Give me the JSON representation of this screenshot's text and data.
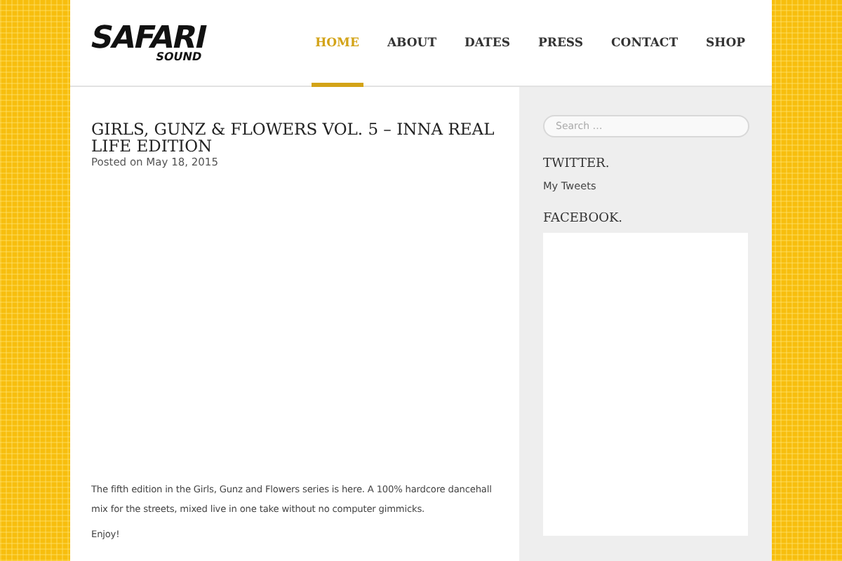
{
  "logo": {
    "main": "SAFARI",
    "sub": "SOUND"
  },
  "nav": [
    {
      "label": "HOME",
      "selected": true
    },
    {
      "label": "ABOUT",
      "selected": false
    },
    {
      "label": "DATES",
      "selected": false
    },
    {
      "label": "PRESS",
      "selected": false
    },
    {
      "label": "CONTACT",
      "selected": false
    },
    {
      "label": "SHOP",
      "selected": false
    }
  ],
  "post": {
    "title": "GIRLS, GUNZ & FLOWERS VOL. 5 – INNA REAL LIFE EDITION",
    "meta": "Posted on May 18, 2015",
    "paragraphs": [
      "The fifth edition in the Girls, Gunz and Flowers series is here. A 100% hardcore dancehall mix for the streets, mixed live in one take without no computer gimmicks.",
      "Enjoy!"
    ]
  },
  "sidebar": {
    "search": {
      "placeholder": "Search …"
    },
    "widgets": [
      {
        "kind": "link",
        "title": "TWITTER.",
        "text": "My Tweets"
      },
      {
        "kind": "embed",
        "title": "FACEBOOK."
      }
    ]
  }
}
